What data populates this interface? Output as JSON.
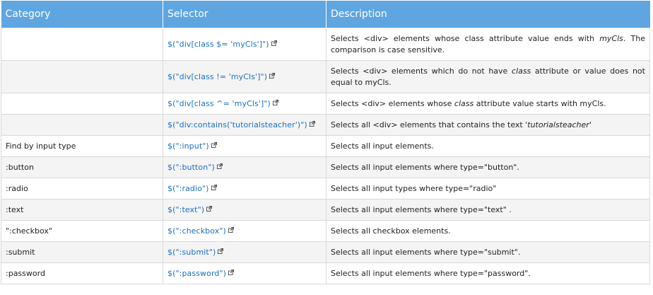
{
  "headers": {
    "category": "Category",
    "selector": "Selector",
    "description": "Description"
  },
  "rows": [
    {
      "category": "",
      "selector": "$(\"div[class $= 'myCls']\")",
      "desc_a": "Selects <div> elements whose class attribute value ends with ",
      "desc_em": "myCls",
      "desc_b": ". The comparison is case sensitive."
    },
    {
      "category": "",
      "selector": "$(\"div[class != 'myCls']\")",
      "desc_a": "Selects <div> elements which do not have ",
      "desc_em": "class",
      "desc_b": " attribute or value does not equal to myCls."
    },
    {
      "category": "",
      "selector": "$(\"div[class ^= 'myCls']\")",
      "desc_a": "Selects <div> elements whose ",
      "desc_em": "class",
      "desc_b": " attribute value starts with myCls."
    },
    {
      "category": "",
      "selector": "$(\"div:contains('tutorialsteacher')\")",
      "desc_a": "Selects all <div> elements that contains the text ",
      "desc_em": "'tutorialsteacher'",
      "desc_b": ""
    },
    {
      "category": "Find by input type",
      "selector": "$(\":input\")",
      "desc_a": "Selects all input elements.",
      "desc_em": "",
      "desc_b": ""
    },
    {
      "category": ":button",
      "selector": "$(\":button\")",
      "desc_a": "Selects all input elements where type=\"button\".",
      "desc_em": "",
      "desc_b": ""
    },
    {
      "category": ":radio",
      "selector": "$(\":radio\")",
      "desc_a": "Selects all input types where type=\"radio\"",
      "desc_em": "",
      "desc_b": ""
    },
    {
      "category": ":text",
      "selector": "$(\":text\")",
      "desc_a": "Selects all input elements where type=\"text\" .",
      "desc_em": "",
      "desc_b": ""
    },
    {
      "category": "\":checkbox\"",
      "selector": "$(\":checkbox\")",
      "desc_a": "Selects all checkbox elements.",
      "desc_em": "",
      "desc_b": ""
    },
    {
      "category": ":submit",
      "selector": "$(\":submit\")",
      "desc_a": "Selects all input elements where type=\"submit\".",
      "desc_em": "",
      "desc_b": ""
    },
    {
      "category": ":password",
      "selector": "$(\":password\")",
      "desc_a": "Selects all input elements where type=\"password\".",
      "desc_em": "",
      "desc_b": ""
    }
  ],
  "colors": {
    "header_bg": "#5fa5e0",
    "link": "#1a6fc4",
    "alt_row": "#f4f4f4"
  },
  "icons": {
    "external_link": "external-link-icon"
  }
}
